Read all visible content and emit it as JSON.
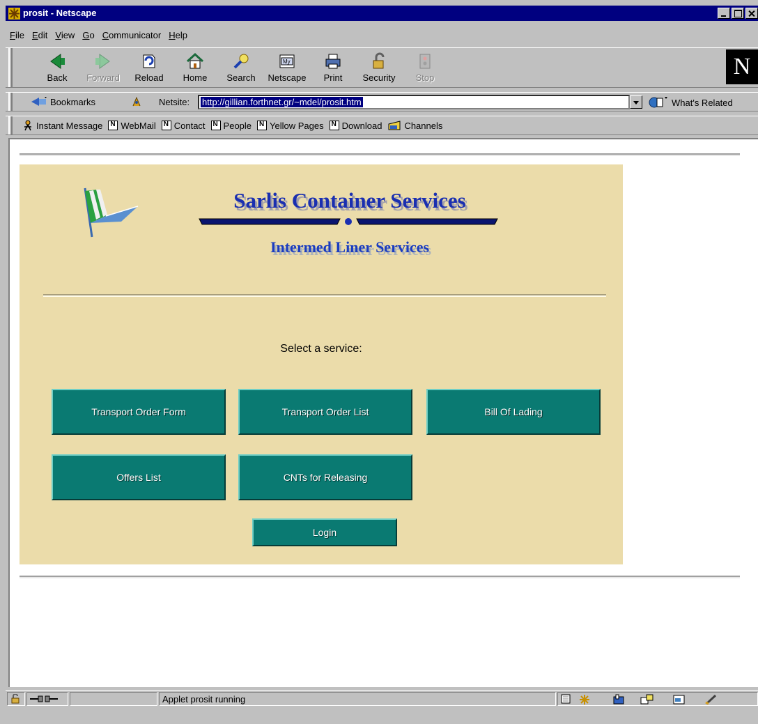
{
  "window": {
    "title": "prosit - Netscape"
  },
  "menu": [
    {
      "u": "F",
      "rest": "ile"
    },
    {
      "u": "E",
      "rest": "dit"
    },
    {
      "u": "V",
      "rest": "iew"
    },
    {
      "u": "G",
      "rest": "o"
    },
    {
      "u": "C",
      "rest": "ommunicator"
    },
    {
      "u": "H",
      "rest": "elp"
    }
  ],
  "toolbar": {
    "back": "Back",
    "forward": "Forward",
    "reload": "Reload",
    "home": "Home",
    "search": "Search",
    "netscape": "Netscape",
    "print": "Print",
    "security": "Security",
    "stop": "Stop",
    "logo": "N"
  },
  "location": {
    "bookmarks": "Bookmarks",
    "label": "Netsite:",
    "url": "http://gillian.forthnet.gr/~mdel/prosit.htm",
    "related": "What's Related"
  },
  "personal": {
    "instant_message": "Instant Message",
    "webmail": "WebMail",
    "contact": "Contact",
    "people": "People",
    "yellow_pages": "Yellow Pages",
    "download": "Download",
    "channels": "Channels"
  },
  "page": {
    "banner_title": "Sarlis Container Services",
    "banner_subtitle": "Intermed Liner Services",
    "prompt": "Select a service:",
    "buttons": {
      "transport_order_form": "Transport Order Form",
      "transport_order_list": "Transport Order List",
      "bill_of_lading": "Bill Of Lading",
      "offers_list": "Offers List",
      "cnts_for_releasing": "CNTs for Releasing",
      "login": "Login"
    }
  },
  "status": {
    "text": "Applet prosit running"
  },
  "colors": {
    "panel": "#ebdcaa",
    "button": "#0a7a72",
    "title_bar": "#000080",
    "banner_text": "#1a2fb0"
  }
}
